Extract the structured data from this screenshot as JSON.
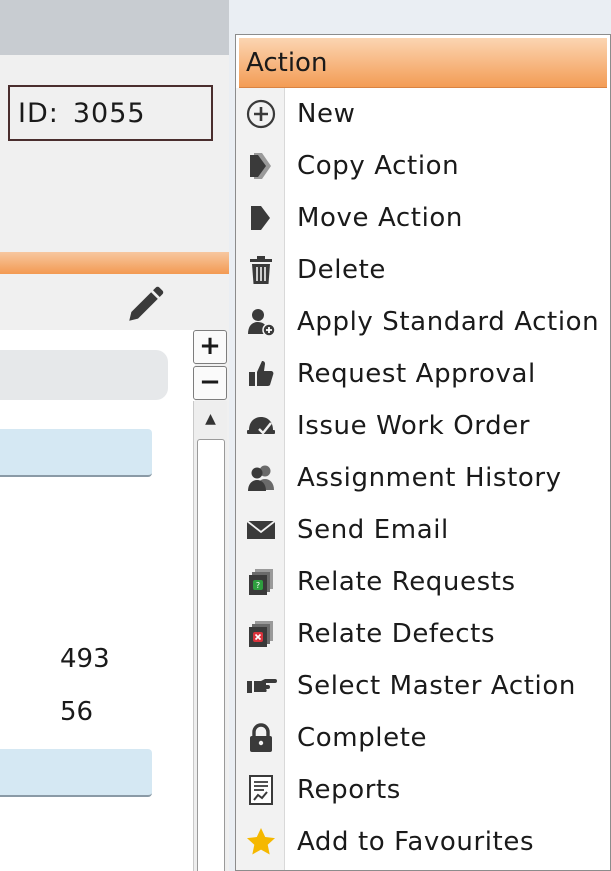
{
  "record": {
    "id_label": "ID:",
    "id_value": "3055"
  },
  "list": {
    "values": [
      "493",
      "56"
    ]
  },
  "zoom": {
    "plus": "+",
    "minus": "−"
  },
  "scroll": {
    "up_arrow": "▲"
  },
  "menu": {
    "header": "Action",
    "items": [
      {
        "label": "New",
        "icon": "plus-circle-icon"
      },
      {
        "label": "Copy Action",
        "icon": "copy-action-icon"
      },
      {
        "label": "Move Action",
        "icon": "move-action-icon"
      },
      {
        "label": "Delete",
        "icon": "trash-icon"
      },
      {
        "label": "Apply Standard Action",
        "icon": "user-add-icon"
      },
      {
        "label": "Request Approval",
        "icon": "thumbs-up-icon"
      },
      {
        "label": "Issue Work Order",
        "icon": "hardhat-check-icon"
      },
      {
        "label": "Assignment History",
        "icon": "users-icon"
      },
      {
        "label": "Send Email",
        "icon": "envelope-icon"
      },
      {
        "label": "Relate Requests",
        "icon": "relate-requests-icon"
      },
      {
        "label": "Relate Defects",
        "icon": "relate-defects-icon"
      },
      {
        "label": "Select Master Action",
        "icon": "pointing-hand-icon"
      },
      {
        "label": "Complete",
        "icon": "lock-icon"
      },
      {
        "label": "Reports",
        "icon": "report-icon"
      },
      {
        "label": "Add to Favourites",
        "icon": "star-icon"
      }
    ]
  },
  "colors": {
    "menu_header_gradient_start": "#fbd5b2",
    "menu_header_gradient_end": "#f39c55",
    "accent_orange": "#f39a52",
    "list_row_blue": "#d5e8f3",
    "favourite_star": "#f5b800",
    "icon_dark": "#3a3a3a"
  }
}
